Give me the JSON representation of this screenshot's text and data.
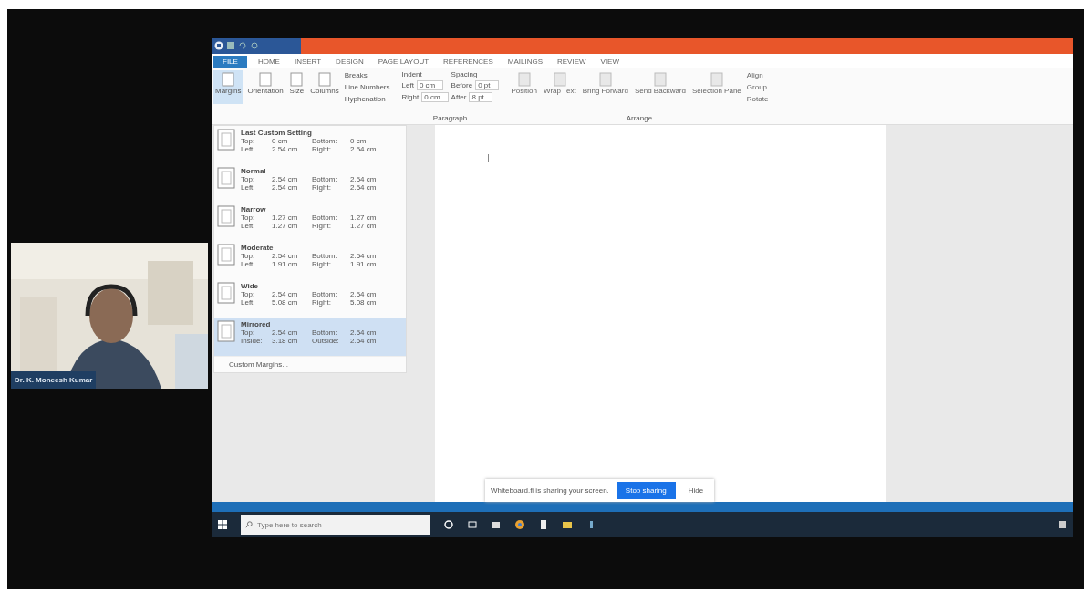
{
  "participant": {
    "name": "Dr. K. Moneesh Kumar"
  },
  "word": {
    "tabs": [
      {
        "label": "FILE",
        "kind": "file"
      },
      {
        "label": "HOME",
        "kind": "tab"
      },
      {
        "label": "INSERT",
        "kind": "tab"
      },
      {
        "label": "DESIGN",
        "kind": "tab"
      },
      {
        "label": "PAGE LAYOUT",
        "kind": "tab"
      },
      {
        "label": "REFERENCES",
        "kind": "tab"
      },
      {
        "label": "MAILINGS",
        "kind": "tab"
      },
      {
        "label": "REVIEW",
        "kind": "tab"
      },
      {
        "label": "VIEW",
        "kind": "tab"
      }
    ],
    "page_setup": [
      {
        "label": "Margins",
        "selected": true
      },
      {
        "label": "Orientation",
        "selected": false
      },
      {
        "label": "Size",
        "selected": false
      },
      {
        "label": "Columns",
        "selected": false
      }
    ],
    "page_setup_small": [
      "Breaks",
      "Line Numbers",
      "Hyphenation"
    ],
    "indent": {
      "title": "Indent",
      "rows": [
        {
          "label": "Left",
          "value": "0 cm"
        },
        {
          "label": "Right",
          "value": "0 cm"
        }
      ]
    },
    "spacing": {
      "title": "Spacing",
      "rows": [
        {
          "label": "Before",
          "value": "0 pt"
        },
        {
          "label": "After",
          "value": "8 pt"
        }
      ]
    },
    "arrange": [
      "Position",
      "Wrap Text",
      "Bring Forward",
      "Send Backward",
      "Selection Pane"
    ],
    "arrange_small": [
      "Align",
      "Group",
      "Rotate"
    ],
    "group_labels": [
      "Paragraph",
      "Arrange"
    ]
  },
  "margins_menu": {
    "items": [
      {
        "name": "Last Custom Setting",
        "selected": false,
        "rows": [
          [
            "Top:",
            "0 cm",
            "Bottom:",
            "0 cm"
          ],
          [
            "Left:",
            "2.54 cm",
            "Right:",
            "2.54 cm"
          ]
        ]
      },
      {
        "name": "Normal",
        "selected": false,
        "rows": [
          [
            "Top:",
            "2.54 cm",
            "Bottom:",
            "2.54 cm"
          ],
          [
            "Left:",
            "2.54 cm",
            "Right:",
            "2.54 cm"
          ]
        ]
      },
      {
        "name": "Narrow",
        "selected": false,
        "rows": [
          [
            "Top:",
            "1.27 cm",
            "Bottom:",
            "1.27 cm"
          ],
          [
            "Left:",
            "1.27 cm",
            "Right:",
            "1.27 cm"
          ]
        ]
      },
      {
        "name": "Moderate",
        "selected": false,
        "rows": [
          [
            "Top:",
            "2.54 cm",
            "Bottom:",
            "2.54 cm"
          ],
          [
            "Left:",
            "1.91 cm",
            "Right:",
            "1.91 cm"
          ]
        ]
      },
      {
        "name": "Wide",
        "selected": false,
        "rows": [
          [
            "Top:",
            "2.54 cm",
            "Bottom:",
            "2.54 cm"
          ],
          [
            "Left:",
            "5.08 cm",
            "Right:",
            "5.08 cm"
          ]
        ]
      },
      {
        "name": "Mirrored",
        "selected": true,
        "rows": [
          [
            "Top:",
            "2.54 cm",
            "Bottom:",
            "2.54 cm"
          ],
          [
            "Inside:",
            "3.18 cm",
            "Outside:",
            "2.54 cm"
          ]
        ]
      }
    ],
    "footer": "Custom Margins..."
  },
  "share_notice": {
    "text": "Whiteboard.fi is sharing your screen.",
    "stop": "Stop sharing",
    "hide": "Hide"
  },
  "taskbar": {
    "search_placeholder": "Type here to search"
  }
}
